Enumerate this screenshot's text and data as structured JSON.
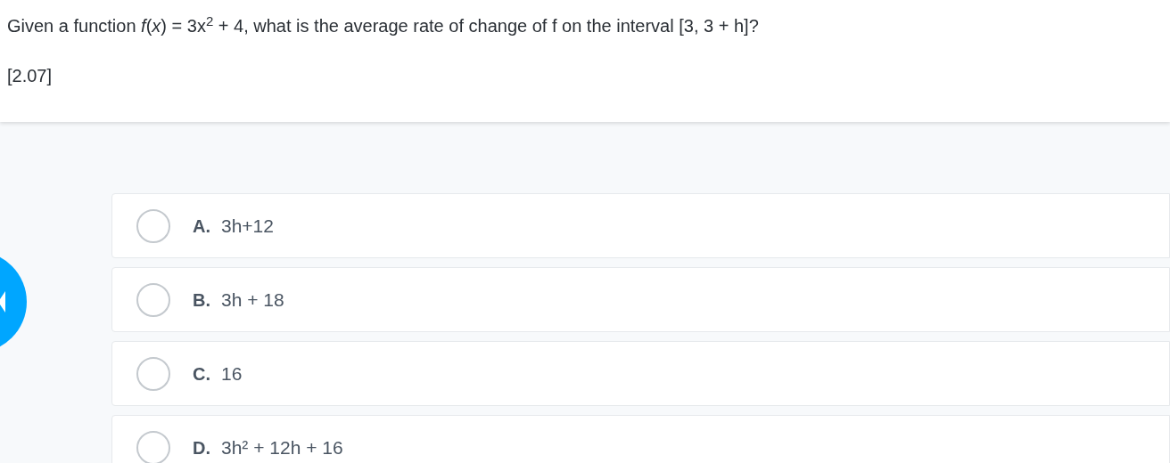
{
  "question": {
    "text": "Given a function *f*(*x*) = 3x$^{2}$ + 4, what is the average rate of change of f on the interval [3, 3 + h]?",
    "tag": "[2.07]"
  },
  "options": [
    {
      "letter": "A.",
      "text": "3h+12",
      "selected": false
    },
    {
      "letter": "B.",
      "text": "3h + 18",
      "selected": false
    },
    {
      "letter": "C.",
      "text": "16",
      "selected": false
    },
    {
      "letter": "D.",
      "text": "3h² + 12h + 16",
      "selected": false
    }
  ]
}
